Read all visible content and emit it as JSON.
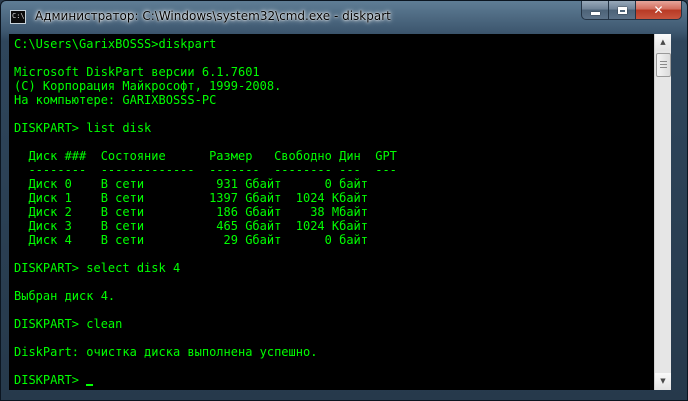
{
  "window": {
    "title": "Администратор: C:\\Windows\\system32\\cmd.exe - diskpart",
    "icon_label": "C:\\"
  },
  "caption_buttons": {
    "close_glyph": "✕"
  },
  "console": {
    "text_color": "#00ff00",
    "background": "#000000",
    "lines": [
      "C:\\Users\\GarixBOSSS>diskpart",
      "",
      "Microsoft DiskPart версии 6.1.7601",
      "(C) Корпорация Майкрософт, 1999-2008.",
      "На компьютере: GARIXBOSSS-PC",
      "",
      "DISKPART> list disk",
      "",
      "  Диск ###  Состояние      Размер   Свободно Дин  GPT",
      "  --------  -------------  -------  -------- ---  ---",
      "  Диск 0    В сети          931 Gбайт      0 байт",
      "  Диск 1    В сети         1397 Gбайт  1024 Кбайт",
      "  Диск 2    В сети          186 Gбайт    38 Мбайт",
      "  Диск 3    В сети          465 Gбайт  1024 Кбайт",
      "  Диск 4    В сети           29 Gбайт      0 байт",
      "",
      "DISKPART> select disk 4",
      "",
      "Выбран диск 4.",
      "",
      "DISKPART> clean",
      "",
      "DiskPart: очистка диска выполнена успешно.",
      "",
      "DISKPART> "
    ]
  },
  "scrollbar": {
    "up_glyph": "▲",
    "down_glyph": "▼"
  }
}
